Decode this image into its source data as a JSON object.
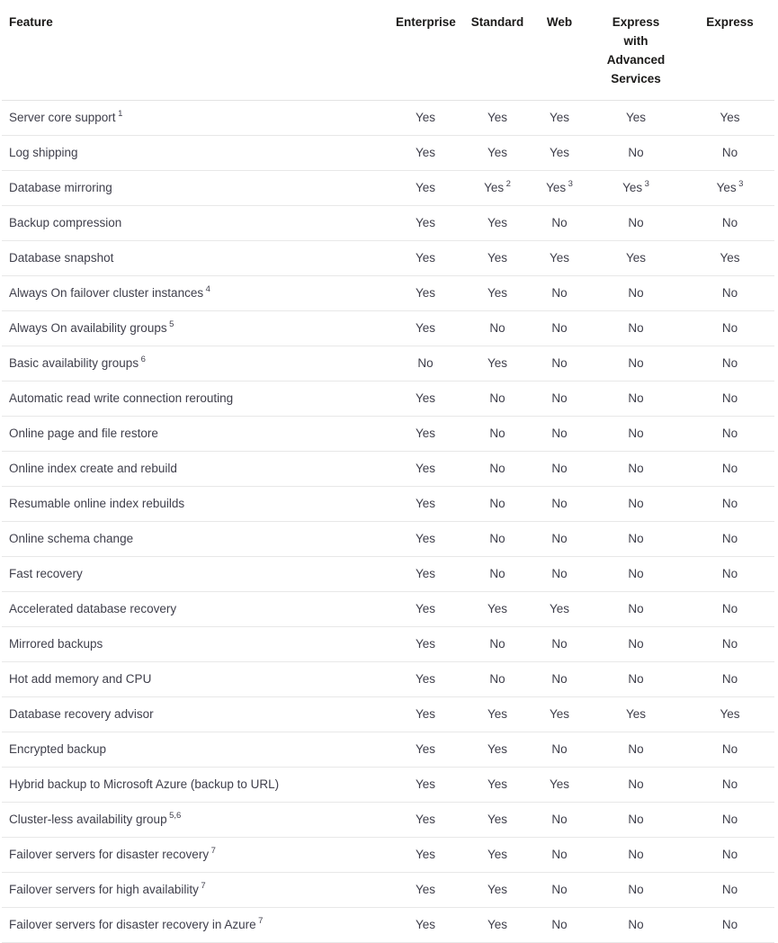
{
  "table": {
    "columns": [
      {
        "key": "feature",
        "label": "Feature",
        "align": "left"
      },
      {
        "key": "enterprise",
        "label": "Enterprise",
        "align": "center"
      },
      {
        "key": "standard",
        "label": "Standard",
        "align": "center"
      },
      {
        "key": "web",
        "label": "Web",
        "align": "center"
      },
      {
        "key": "express_adv",
        "label": "Express with Advanced Services",
        "label_lines": [
          "Express",
          "with",
          "Advanced",
          "Services"
        ],
        "align": "center"
      },
      {
        "key": "express",
        "label": "Express",
        "align": "center"
      }
    ],
    "rows": [
      {
        "feature": "Server core support",
        "feature_note": "1",
        "enterprise": "Yes",
        "standard": "Yes",
        "web": "Yes",
        "express_adv": "Yes",
        "express": "Yes"
      },
      {
        "feature": "Log shipping",
        "feature_note": "",
        "enterprise": "Yes",
        "standard": "Yes",
        "web": "Yes",
        "express_adv": "No",
        "express": "No"
      },
      {
        "feature": "Database mirroring",
        "feature_note": "",
        "enterprise": "Yes",
        "standard": "Yes",
        "standard_note": "2",
        "web": "Yes",
        "web_note": "3",
        "express_adv": "Yes",
        "express_adv_note": "3",
        "express": "Yes",
        "express_note": "3"
      },
      {
        "feature": "Backup compression",
        "feature_note": "",
        "enterprise": "Yes",
        "standard": "Yes",
        "web": "No",
        "express_adv": "No",
        "express": "No"
      },
      {
        "feature": "Database snapshot",
        "feature_note": "",
        "enterprise": "Yes",
        "standard": "Yes",
        "web": "Yes",
        "express_adv": "Yes",
        "express": "Yes"
      },
      {
        "feature": "Always On failover cluster instances",
        "feature_note": "4",
        "enterprise": "Yes",
        "standard": "Yes",
        "web": "No",
        "express_adv": "No",
        "express": "No"
      },
      {
        "feature": "Always On availability groups",
        "feature_note": "5",
        "enterprise": "Yes",
        "standard": "No",
        "web": "No",
        "express_adv": "No",
        "express": "No"
      },
      {
        "feature": "Basic availability groups",
        "feature_note": "6",
        "enterprise": "No",
        "standard": "Yes",
        "web": "No",
        "express_adv": "No",
        "express": "No"
      },
      {
        "feature": "Automatic read write connection rerouting",
        "feature_note": "",
        "enterprise": "Yes",
        "standard": "No",
        "web": "No",
        "express_adv": "No",
        "express": "No"
      },
      {
        "feature": "Online page and file restore",
        "feature_note": "",
        "enterprise": "Yes",
        "standard": "No",
        "web": "No",
        "express_adv": "No",
        "express": "No"
      },
      {
        "feature": "Online index create and rebuild",
        "feature_note": "",
        "enterprise": "Yes",
        "standard": "No",
        "web": "No",
        "express_adv": "No",
        "express": "No"
      },
      {
        "feature": "Resumable online index rebuilds",
        "feature_note": "",
        "enterprise": "Yes",
        "standard": "No",
        "web": "No",
        "express_adv": "No",
        "express": "No"
      },
      {
        "feature": "Online schema change",
        "feature_note": "",
        "enterprise": "Yes",
        "standard": "No",
        "web": "No",
        "express_adv": "No",
        "express": "No"
      },
      {
        "feature": "Fast recovery",
        "feature_note": "",
        "enterprise": "Yes",
        "standard": "No",
        "web": "No",
        "express_adv": "No",
        "express": "No"
      },
      {
        "feature": "Accelerated database recovery",
        "feature_note": "",
        "enterprise": "Yes",
        "standard": "Yes",
        "web": "Yes",
        "express_adv": "No",
        "express": "No"
      },
      {
        "feature": "Mirrored backups",
        "feature_note": "",
        "enterprise": "Yes",
        "standard": "No",
        "web": "No",
        "express_adv": "No",
        "express": "No"
      },
      {
        "feature": "Hot add memory and CPU",
        "feature_note": "",
        "enterprise": "Yes",
        "standard": "No",
        "web": "No",
        "express_adv": "No",
        "express": "No"
      },
      {
        "feature": "Database recovery advisor",
        "feature_note": "",
        "enterprise": "Yes",
        "standard": "Yes",
        "web": "Yes",
        "express_adv": "Yes",
        "express": "Yes"
      },
      {
        "feature": "Encrypted backup",
        "feature_note": "",
        "enterprise": "Yes",
        "standard": "Yes",
        "web": "No",
        "express_adv": "No",
        "express": "No"
      },
      {
        "feature": "Hybrid backup to Microsoft Azure (backup to URL)",
        "feature_note": "",
        "enterprise": "Yes",
        "standard": "Yes",
        "web": "Yes",
        "express_adv": "No",
        "express": "No"
      },
      {
        "feature": "Cluster-less availability group",
        "feature_note": "5,6",
        "enterprise": "Yes",
        "standard": "Yes",
        "web": "No",
        "express_adv": "No",
        "express": "No"
      },
      {
        "feature": "Failover servers for disaster recovery",
        "feature_note": "7",
        "enterprise": "Yes",
        "standard": "Yes",
        "web": "No",
        "express_adv": "No",
        "express": "No"
      },
      {
        "feature": "Failover servers for high availability",
        "feature_note": "7",
        "enterprise": "Yes",
        "standard": "Yes",
        "web": "No",
        "express_adv": "No",
        "express": "No"
      },
      {
        "feature": "Failover servers for disaster recovery in Azure",
        "feature_note": "7",
        "enterprise": "Yes",
        "standard": "Yes",
        "web": "No",
        "express_adv": "No",
        "express": "No"
      }
    ]
  },
  "colors": {
    "header_text": "#1b1a19",
    "body_text": "#3f3f4b",
    "row_border": "#e8e8e8",
    "background": "#ffffff"
  }
}
